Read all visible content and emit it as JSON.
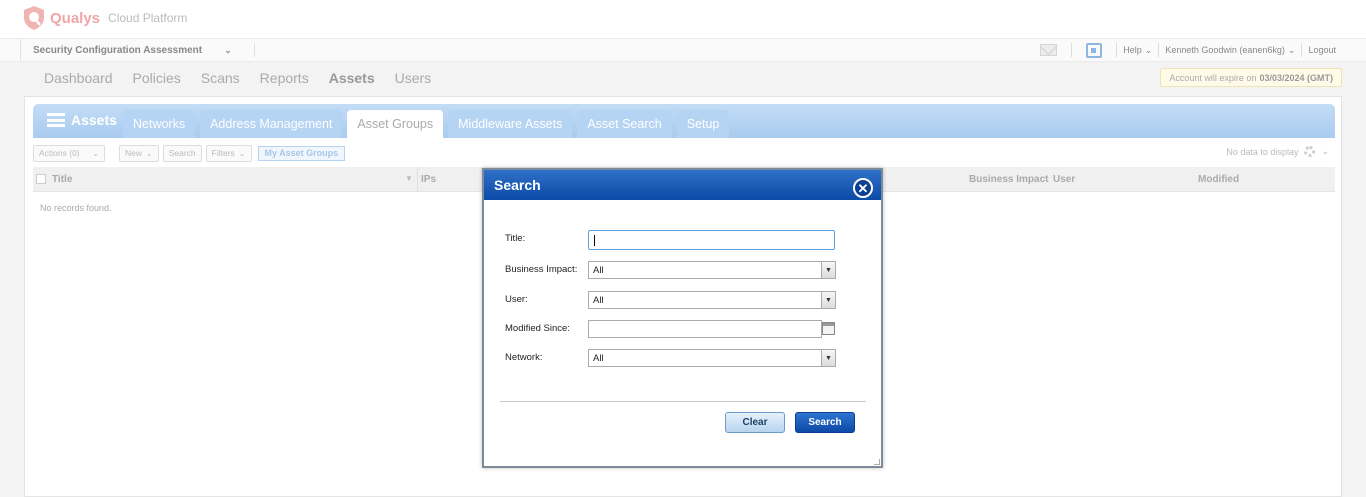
{
  "brand": {
    "name": "Qualys",
    "sub": "Cloud Platform"
  },
  "module": {
    "label": "Security Configuration Assessment"
  },
  "utility": {
    "help": "Help",
    "user": "Kenneth Goodwin (eanen6kg)",
    "logout": "Logout"
  },
  "main_nav": [
    "Dashboard",
    "Policies",
    "Scans",
    "Reports",
    "Assets",
    "Users"
  ],
  "expire": {
    "prefix": "Account will expire on",
    "date": "03/03/2024 (GMT)"
  },
  "tabbar": {
    "title": "Assets",
    "tabs": [
      "Networks",
      "Address Management",
      "Asset Groups",
      "Middleware Assets",
      "Asset Search",
      "Setup"
    ],
    "active_tab": "Asset Groups"
  },
  "toolbar": {
    "actions": "Actions (0)",
    "new": "New",
    "search": "Search",
    "filters": "Filters",
    "my_asset_groups": "My Asset Groups",
    "no_data": "No data to display"
  },
  "table": {
    "columns": [
      "Title",
      "IPs",
      "Business Impact",
      "User",
      "Modified"
    ],
    "empty": "No records found."
  },
  "dialog": {
    "title": "Search",
    "fields": {
      "title_label": "Title:",
      "business_impact_label": "Business Impact:",
      "business_impact_value": "All",
      "user_label": "User:",
      "user_value": "All",
      "modified_since_label": "Modified Since:",
      "network_label": "Network:",
      "network_value": "All"
    },
    "clear": "Clear",
    "search": "Search"
  },
  "colors": {
    "dialog_header": "#0b4aa6",
    "tabbar": "#a9cbef",
    "brand": "#e25d5d"
  }
}
